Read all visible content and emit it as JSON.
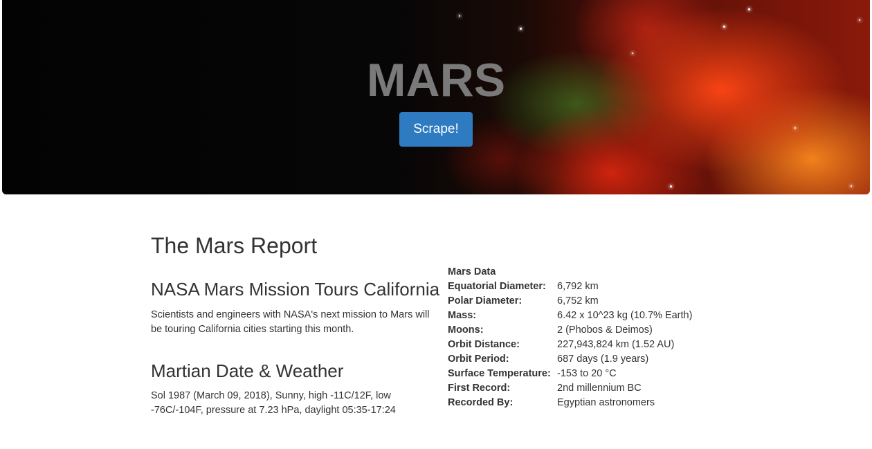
{
  "hero": {
    "title": "MARS",
    "scrape_label": "Scrape!"
  },
  "report": {
    "title": "The Mars Report",
    "news_title": "NASA Mars Mission Tours California",
    "news_paragraph": "Scientists and engineers with NASA's next mission to Mars will be touring California cities starting this month.",
    "weather_title": "Martian Date & Weather",
    "weather_text": "Sol 1987 (March 09, 2018), Sunny, high -11C/12F, low -76C/-104F, pressure at 7.23 hPa, daylight 05:35-17:24"
  },
  "facts": {
    "header": "Mars Data",
    "rows": [
      {
        "label": "Equatorial Diameter:",
        "value": "6,792 km"
      },
      {
        "label": "Polar Diameter:",
        "value": "6,752 km"
      },
      {
        "label": "Mass:",
        "value": "6.42 x 10^23 kg (10.7% Earth)"
      },
      {
        "label": "Moons:",
        "value": "2 (Phobos & Deimos)"
      },
      {
        "label": "Orbit Distance:",
        "value": "227,943,824 km (1.52 AU)"
      },
      {
        "label": "Orbit Period:",
        "value": "687 days (1.9 years)"
      },
      {
        "label": "Surface Temperature:",
        "value": "-153 to 20 °C"
      },
      {
        "label": "First Record:",
        "value": "2nd millennium BC"
      },
      {
        "label": "Recorded By:",
        "value": "Egyptian astronomers"
      }
    ]
  }
}
